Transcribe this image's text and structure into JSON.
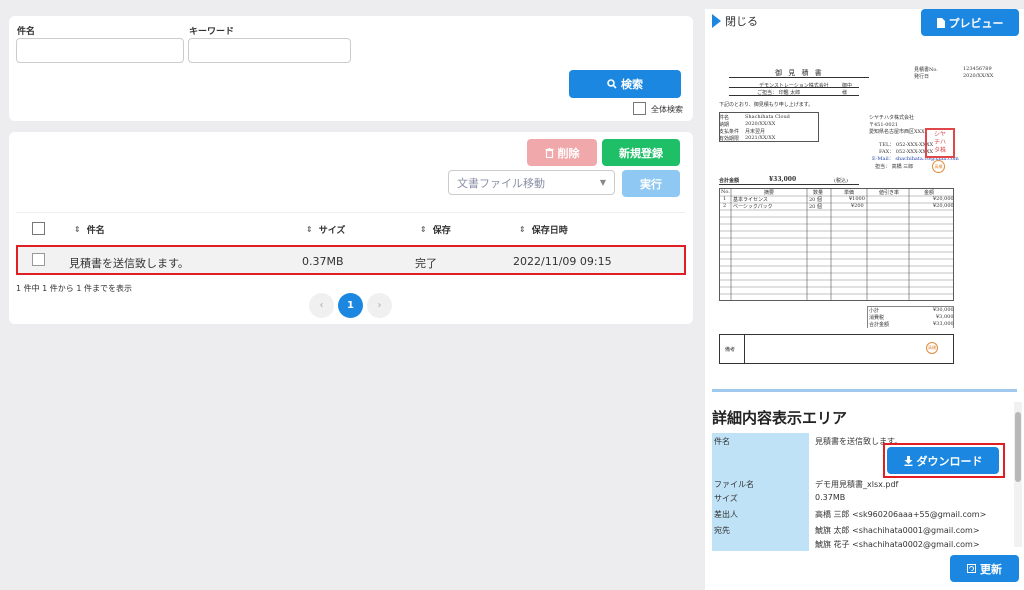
{
  "search": {
    "subject_label": "件名",
    "keyword_label": "キーワード",
    "search_button": "検索",
    "all_search_label": "全体検索"
  },
  "list": {
    "delete_button": "削除",
    "new_button": "新規登録",
    "move_select": "文書ファイル移動",
    "run_button": "実行",
    "columns": [
      "件名",
      "サイズ",
      "保存",
      "保存日時"
    ],
    "rows": [
      {
        "subject": "見積書を送信致します。",
        "size": "0.37MB",
        "status": "完了",
        "saved_at": "2022/11/09 09:15"
      }
    ],
    "count_text": "1 件中 1 件から 1 件までを表示",
    "page": "1",
    "prev": "‹",
    "next": "›"
  },
  "panel": {
    "close_label": "閉じる",
    "preview_button": "プレビュー",
    "update_button": "更新",
    "download_button": "ダウンロード"
  },
  "document": {
    "title": "御 見 積 書",
    "no_label": "見積書No.",
    "no_value": "123456789",
    "date_label": "発行日",
    "date_value": "2020/XX/XX",
    "client": "デモンストレーション株式会社",
    "client_suffix": "御中",
    "contact": "ご担当： 印鑑 太郎",
    "contact_suffix": "様",
    "intro": "下記のとおり、御見積もり申し上げます。",
    "info_rows": [
      [
        "件名",
        "Shachihata Cloud"
      ],
      [
        "納期",
        "2020/XX/XX"
      ],
      [
        "支払条件",
        "月末翌月"
      ],
      [
        "有効期限",
        "2021/XX/XX"
      ]
    ],
    "company": "シヤチハタ株式会社",
    "postal": "〒451-0021",
    "address": "愛知県名古屋市西区XXX",
    "tel": "TEL： 052-XXX-XXXX",
    "fax": "FAX： 052-XXX-XXXX",
    "mail": "E-Mail： shachihata.co@xxxx.com",
    "person": "担当：  高橋 三郎",
    "total_label": "合計金額",
    "total_value": "¥33,000",
    "tax_note": "(税込)",
    "table_headers": [
      "No.",
      "摘要",
      "数量",
      "単価",
      "値引き率",
      "金額"
    ],
    "items": [
      [
        "1",
        "基本ライセンス",
        "20 個",
        "¥1000",
        "",
        "¥20,000"
      ],
      [
        "2",
        "ベーシックパック",
        "20 個",
        "¥200",
        "",
        "¥20,000"
      ]
    ],
    "subtotal_label": "小計",
    "subtotal_value": "¥30,000",
    "tax_label": "消費税",
    "tax_value": "¥3,000",
    "grand_label": "合計金額",
    "grand_value": "¥33,000",
    "remarks_label": "備考",
    "stamp_text": "高橋",
    "seal_lines": [
      "シヤ",
      "チハ",
      "タ株"
    ]
  },
  "details": {
    "title": "詳細内容表示エリア",
    "subject_key": "件名",
    "subject_val": "見積書を送信致します。",
    "file_key": "ファイル名",
    "file_val": "デモ用見積書_xlsx.pdf",
    "size_key": "サイズ",
    "size_val": "0.37MB",
    "sender_key": "差出人",
    "sender_val": "高橋 三郎 <sk960206aaa+55@gmail.com>",
    "to_key": "宛先",
    "to_val1": "鯱旗 太郎 <shachihata0001@gmail.com>",
    "to_val2": "鯱旗 花子 <shachihata0002@gmail.com>"
  }
}
